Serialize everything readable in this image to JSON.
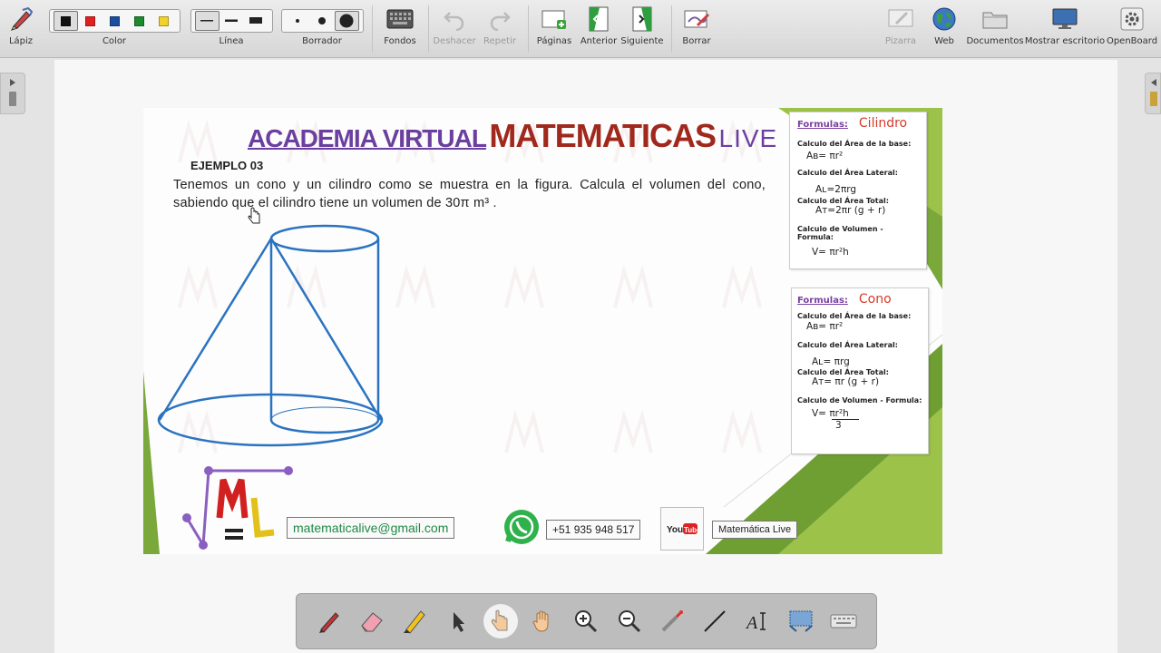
{
  "toolbar": {
    "pen_label": "Lápiz",
    "color_label": "Color",
    "colors": [
      "#111111",
      "#e02020",
      "#1c4fa0",
      "#1e8a2e",
      "#f2d22a"
    ],
    "line_label": "Línea",
    "eraser_label": "Borrador",
    "backgrounds_label": "Fondos",
    "undo_label": "Deshacer",
    "redo_label": "Repetir",
    "pages_label": "Páginas",
    "previous_label": "Anterior",
    "next_label": "Siguiente",
    "clear_label": "Borrar",
    "board_label": "Pizarra",
    "web_label": "Web",
    "documents_label": "Documentos",
    "desktop_label": "Mostrar escritorio",
    "openboard_label": "OpenBoard"
  },
  "slide": {
    "title_part1": "ACADEMIA VIRTUAL",
    "title_part2": "MATEMATICAS",
    "title_part3": "LIVE",
    "example_label": "EJEMPLO 03",
    "problem_text": "Tenemos un cono y un cilindro como se muestra en la figura. Calcula el volumen del cono, sabiendo que el cilindro tiene un volumen de 30π m³ .",
    "cylinder_card": {
      "formulas_label": "Formulas:",
      "name": "Cilindro",
      "base_area_label": "Calculo del Área de la base:",
      "base_area_eq": "Aʙ= πr²",
      "lateral_label": "Calculo del Área Lateral:",
      "lateral_eq": "Aʟ=2πrg",
      "total_label": "Calculo del Área Total:",
      "total_eq": "Aᴛ=2πr (g + r)",
      "volume_label": "Calculo de Volumen - Formula:",
      "volume_eq": "V= πr²h"
    },
    "cone_card": {
      "formulas_label": "Formulas:",
      "name": "Cono",
      "base_area_label": "Calculo del Área de la base:",
      "base_area_eq": "Aʙ= πr²",
      "lateral_label": "Calculo del Área Lateral:",
      "lateral_eq": "Aʟ= πrg",
      "total_label": "Calculo del Área Total:",
      "total_eq": "Aᴛ= πr (g + r)",
      "volume_label": "Calculo de Volumen - Formula:",
      "volume_eq_num": "V= πr²h",
      "volume_eq_den": "3"
    },
    "email": "matematicalive@gmail.com",
    "phone": "+51 935 948 517",
    "youtube_label": "Matemática Live"
  }
}
